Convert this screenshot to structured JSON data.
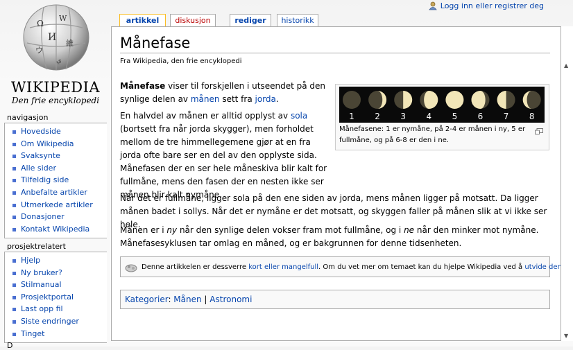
{
  "logo": {
    "wordmark": "WIKIPEDIA",
    "tagline": "Den frie encyklopedi"
  },
  "personal": {
    "login_link": "Logg inn eller registrer deg"
  },
  "tabs": [
    {
      "label": "artikkel"
    },
    {
      "label": "diskusjon"
    },
    {
      "label": "rediger"
    },
    {
      "label": "historikk"
    }
  ],
  "navigation": {
    "heading": "navigasjon",
    "items": [
      "Hovedside",
      "Om Wikipedia",
      "Svaksynte",
      "Alle sider",
      "Tilfeldig side",
      "Anbefalte artikler",
      "Utmerkede artikler",
      "Donasjoner",
      "Kontakt Wikipedia"
    ]
  },
  "project": {
    "heading": "prosjektrelatert",
    "items": [
      "Hjelp",
      "Ny bruker?",
      "Stilmanual",
      "Prosjektportal",
      "Last opp fil",
      "Siste endringer",
      "Tinget"
    ]
  },
  "more_heading": "D",
  "article": {
    "title": "Månefase",
    "sitesub": "Fra Wikipedia, den frie encyklopedi",
    "p1": {
      "bold": "Månefase",
      "t1": " viser til forskjellen i utseendet på den synlige delen av ",
      "l1": "månen",
      "t2": " sett fra ",
      "l2": "jorda",
      "t3": "."
    },
    "p2": {
      "t1": "En halvdel av månen er alltid opplyst av ",
      "l1": "sola",
      "t2": " (bortsett fra når jorda skygger), men forholdet mellom de tre himmellegemene gjør at en fra jorda ofte bare ser en del av den opplyste sida. Månefasen der en ser hele måneskiva blir kalt for fullmåne, mens den fasen der en nesten ikke ser månen blir kalt nymåne."
    },
    "p3": "Når det er fullmåne, ligger sola på den ene siden av jorda, mens månen ligger på motsatt. Da ligger månen badet i sollys. Når det er nymåne er det motsatt, og skyggen faller på månen slik at vi ikke ser hele.",
    "p4": {
      "t1": "Månen er i ",
      "i1": "ny",
      "t2": " når den synlige delen vokser fram mot fullmåne, og i ",
      "i2": "ne",
      "t3": " når den minker mot nymåne. Månefasesyklusen tar omlag en måned, og er bakgrunnen for denne tidsenheten."
    },
    "thumb": {
      "numbers": [
        "1",
        "2",
        "3",
        "4",
        "5",
        "6",
        "7",
        "8"
      ],
      "caption": "Månefasene: 1 er nymåne, på 2-4 er månen i ny, 5 er fullmåne, og på 6-8 er den i ne."
    },
    "stub": {
      "t1": "Denne artikkelen er dessverre ",
      "l1": "kort eller mangelfull",
      "t2": ". Om du vet mer om temaet kan du hjelpe Wikipedia ved å ",
      "l2": "utvide den",
      "t3": "."
    },
    "categories": {
      "label": "Kategorier",
      "items": [
        "Månen",
        "Astronomi"
      ]
    }
  }
}
